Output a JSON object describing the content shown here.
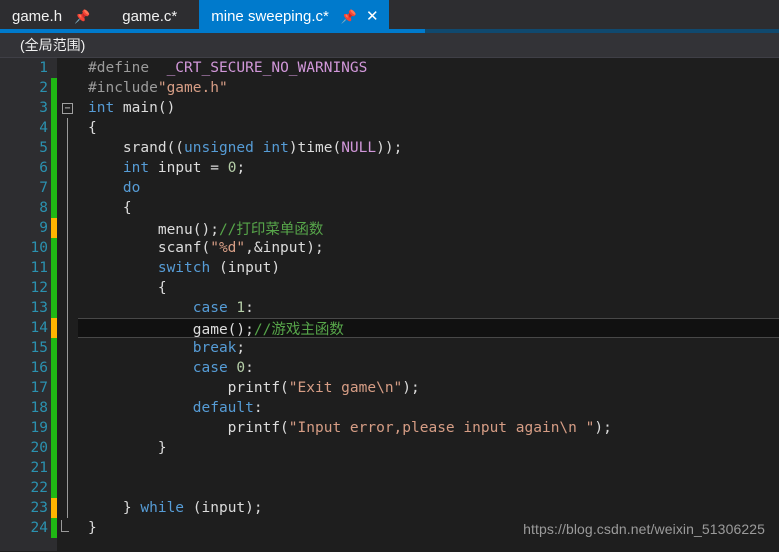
{
  "colors": {
    "accent": "#007acc",
    "tabbar_bg": "#2d2d30",
    "scopebar_bg": "#333337",
    "editor_bg": "#1e1e1e",
    "linenumber": "#2b91af",
    "change_saved": "#1fb714",
    "change_unsaved": "#ffb400",
    "keyword": "#569cd6",
    "string": "#d69d85",
    "comment": "#57a64a",
    "macro": "#d197d9",
    "preprocessor": "#9b9b9b",
    "text": "#dcdcdc"
  },
  "tabs": [
    {
      "label": "game.h",
      "active": false,
      "pin_icon": "pin-icon",
      "has_close": false
    },
    {
      "label": "game.c*",
      "active": false,
      "pin_icon": null,
      "has_close": false
    },
    {
      "label": "mine sweeping.c*",
      "active": true,
      "pin_icon": "pin-icon",
      "has_close": true,
      "close_icon": "close-icon"
    }
  ],
  "scopebar": {
    "scope": "(全局范围)"
  },
  "editor": {
    "watermark": "https://blog.csdn.net/weixin_51306225",
    "lines": [
      {
        "n": "1",
        "marker": "none",
        "text": "#define  _CRT_SECURE_NO_WARNINGS"
      },
      {
        "n": "2",
        "marker": "green",
        "text": "#include\"game.h\""
      },
      {
        "n": "3",
        "marker": "green",
        "text": "int main()"
      },
      {
        "n": "4",
        "marker": "green",
        "text": "{"
      },
      {
        "n": "5",
        "marker": "green",
        "text": "    srand((unsigned int)time(NULL));"
      },
      {
        "n": "6",
        "marker": "green",
        "text": "    int input = 0;"
      },
      {
        "n": "7",
        "marker": "green",
        "text": "    do"
      },
      {
        "n": "8",
        "marker": "green",
        "text": "    {"
      },
      {
        "n": "9",
        "marker": "orange",
        "text": "        menu();//打印菜单函数"
      },
      {
        "n": "10",
        "marker": "green",
        "text": "        scanf(\"%d\",&input);"
      },
      {
        "n": "11",
        "marker": "green",
        "text": "        switch (input)"
      },
      {
        "n": "12",
        "marker": "green",
        "text": "        {"
      },
      {
        "n": "13",
        "marker": "green",
        "text": "            case 1:"
      },
      {
        "n": "14",
        "marker": "orange",
        "text": "            game();//游戏主函数",
        "current": true
      },
      {
        "n": "15",
        "marker": "green",
        "text": "            break;"
      },
      {
        "n": "16",
        "marker": "green",
        "text": "            case 0:"
      },
      {
        "n": "17",
        "marker": "green",
        "text": "                printf(\"Exit game\\n\");"
      },
      {
        "n": "18",
        "marker": "green",
        "text": "            default:"
      },
      {
        "n": "19",
        "marker": "green",
        "text": "                printf(\"Input error,please input again\\n \");"
      },
      {
        "n": "20",
        "marker": "green",
        "text": "        }"
      },
      {
        "n": "21",
        "marker": "green",
        "text": ""
      },
      {
        "n": "22",
        "marker": "green",
        "text": ""
      },
      {
        "n": "23",
        "marker": "orange",
        "text": "    } while (input);"
      },
      {
        "n": "24",
        "marker": "green",
        "text": "}"
      }
    ]
  }
}
